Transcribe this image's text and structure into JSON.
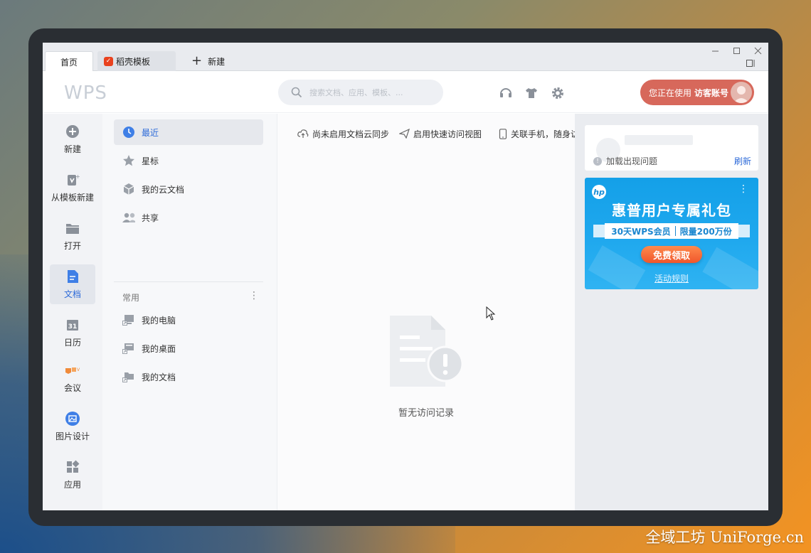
{
  "tabs": [
    {
      "label": "首页",
      "active": true
    },
    {
      "label": "稻壳模板",
      "icon": "docer-icon"
    },
    {
      "label": "新建",
      "icon": "plus-icon"
    }
  ],
  "window_controls": [
    "minimize",
    "maximize",
    "close",
    "layout"
  ],
  "header": {
    "logo": "WPS",
    "search_placeholder": "搜索文档、应用、模板、...",
    "icons": [
      "headset-icon",
      "skin-icon",
      "settings-icon"
    ],
    "guest_prefix": "您正在使用",
    "guest_label": "访客账号"
  },
  "rail": [
    {
      "label": "新建",
      "icon": "plus-circle-icon"
    },
    {
      "label": "从模板新建",
      "icon": "template-icon"
    },
    {
      "label": "打开",
      "icon": "folder-icon"
    },
    {
      "label": "文档",
      "icon": "document-icon",
      "active": true
    },
    {
      "label": "日历",
      "icon": "calendar-icon",
      "icon_text": "31"
    },
    {
      "label": "会议",
      "icon": "meeting-icon"
    },
    {
      "label": "图片设计",
      "icon": "image-design-icon"
    },
    {
      "label": "应用",
      "icon": "apps-icon"
    }
  ],
  "nav": {
    "items": [
      {
        "label": "最近",
        "icon": "clock-icon",
        "active": true
      },
      {
        "label": "星标",
        "icon": "star-icon"
      },
      {
        "label": "我的云文档",
        "icon": "cloud-box-icon"
      },
      {
        "label": "共享",
        "icon": "share-users-icon"
      }
    ],
    "section_title": "常用",
    "common": [
      {
        "label": "我的电脑",
        "icon": "computer-shortcut-icon"
      },
      {
        "label": "我的桌面",
        "icon": "desktop-shortcut-icon"
      },
      {
        "label": "我的文档",
        "icon": "documents-shortcut-icon"
      }
    ]
  },
  "main": {
    "toolbar": [
      {
        "label": "尚未启用文档云同步",
        "icon": "cloud-sync-icon"
      },
      {
        "label": "启用快速访问视图",
        "icon": "send-icon"
      },
      {
        "label": "关联手机，随身访问",
        "icon": "phone-icon"
      }
    ],
    "empty_text": "暂无访问记录"
  },
  "right": {
    "card": {
      "error_text": "加载出现问题",
      "refresh_label": "刷新"
    },
    "ad": {
      "brand": "hp",
      "title": "惠普用户专属礼包",
      "ribbon_left": "30天WPS会员",
      "ribbon_right": "限量200万份",
      "button": "免费领取",
      "rules": "活动规则"
    }
  },
  "watermark": "全域工坊 UniForge.cn",
  "colors": {
    "accent": "#2e6bd9",
    "guest_button": "#d7685b",
    "ad_blue": "#1fa8ee",
    "ad_button": "#f0562c"
  }
}
